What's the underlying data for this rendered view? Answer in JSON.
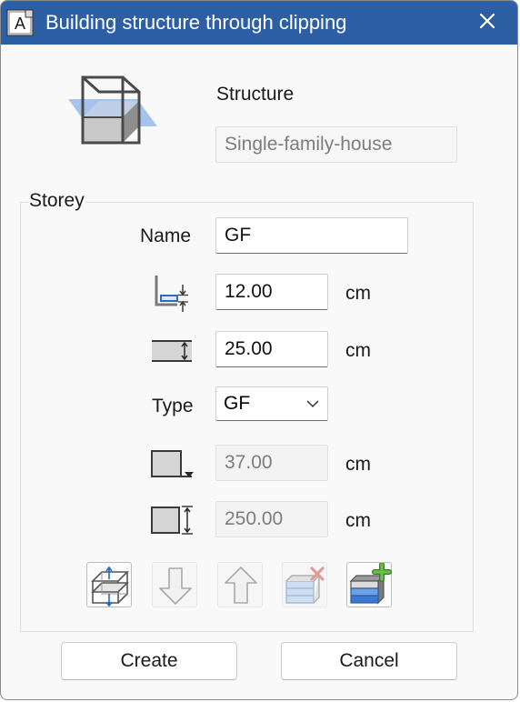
{
  "window": {
    "title": "Building structure through clipping",
    "app_icon_letter": "A",
    "title_bar_color": "#2c5fa3",
    "icons": {
      "app": "app-document-icon",
      "close": "close-icon"
    }
  },
  "structure": {
    "label": "Structure",
    "value": "Single-family-house",
    "icon": "building-clipping-icon"
  },
  "storey": {
    "group_label": "Storey",
    "name_label": "Name",
    "name_value": "GF",
    "bottom_offset": {
      "value": "12.00",
      "unit": "cm",
      "icon": "bottom-offset-icon"
    },
    "slab_thickness": {
      "value": "25.00",
      "unit": "cm",
      "icon": "slab-thickness-icon"
    },
    "type_label": "Type",
    "type_value": "GF",
    "level_height": {
      "value": "37.00",
      "unit": "cm",
      "icon": "level-height-icon"
    },
    "storey_height": {
      "value": "250.00",
      "unit": "cm",
      "icon": "storey-height-icon"
    }
  },
  "toolbar": {
    "items": [
      {
        "name": "clip-storey-button",
        "icon": "clip-storey-icon",
        "enabled": true
      },
      {
        "name": "move-down-button",
        "icon": "arrow-down-icon",
        "enabled": false
      },
      {
        "name": "move-up-button",
        "icon": "arrow-up-icon",
        "enabled": false
      },
      {
        "name": "delete-storey-button",
        "icon": "delete-storey-icon",
        "enabled": false
      },
      {
        "name": "add-storey-button",
        "icon": "add-storey-icon",
        "enabled": true
      }
    ]
  },
  "buttons": {
    "create": "Create",
    "cancel": "Cancel"
  }
}
